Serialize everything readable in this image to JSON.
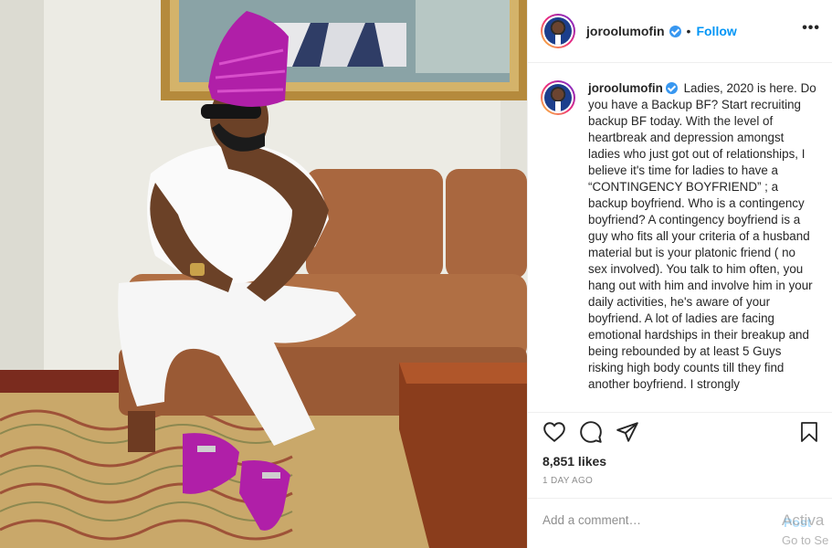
{
  "post": {
    "username": "joroolumofin",
    "follow_label": "Follow",
    "separator": "•",
    "more_label": "•••",
    "caption": "Ladies, 2020 is here. Do you have a Backup BF? Start recruiting backup BF today. With the level of heartbreak and depression amongst ladies who just got out of relationships, I believe it's time for ladies to have a “CONTINGENCY BOYFRIEND” ; a backup boyfriend. Who is a contingency boyfriend? A contingency boyfriend is a guy who fits all your criteria of a husband material but is your platonic friend ( no sex involved). You talk to him often, you hang out with him and involve him in your daily activities, he's aware of your boyfriend. A lot of ladies are facing emotional hardships in their breakup and being rebounded by at least 5 Guys risking high body counts till they find another boyfriend. I strongly",
    "likes": "8,851 likes",
    "time": "1 DAY AGO",
    "comment_placeholder": "Add a comment…",
    "post_label": "Post"
  },
  "icons": {
    "like": "heart-icon",
    "comment": "comment-icon",
    "share": "share-icon",
    "save": "bookmark-icon",
    "verified": "verified-badge-icon"
  },
  "watermark": {
    "line1": "Activa",
    "line2": "Go to Se"
  },
  "colors": {
    "accent": "#0095f6",
    "verified": "#3897f0",
    "muted": "#8e8e8e",
    "border": "#efefef",
    "hat_and_shoes": "#b01fa8"
  }
}
